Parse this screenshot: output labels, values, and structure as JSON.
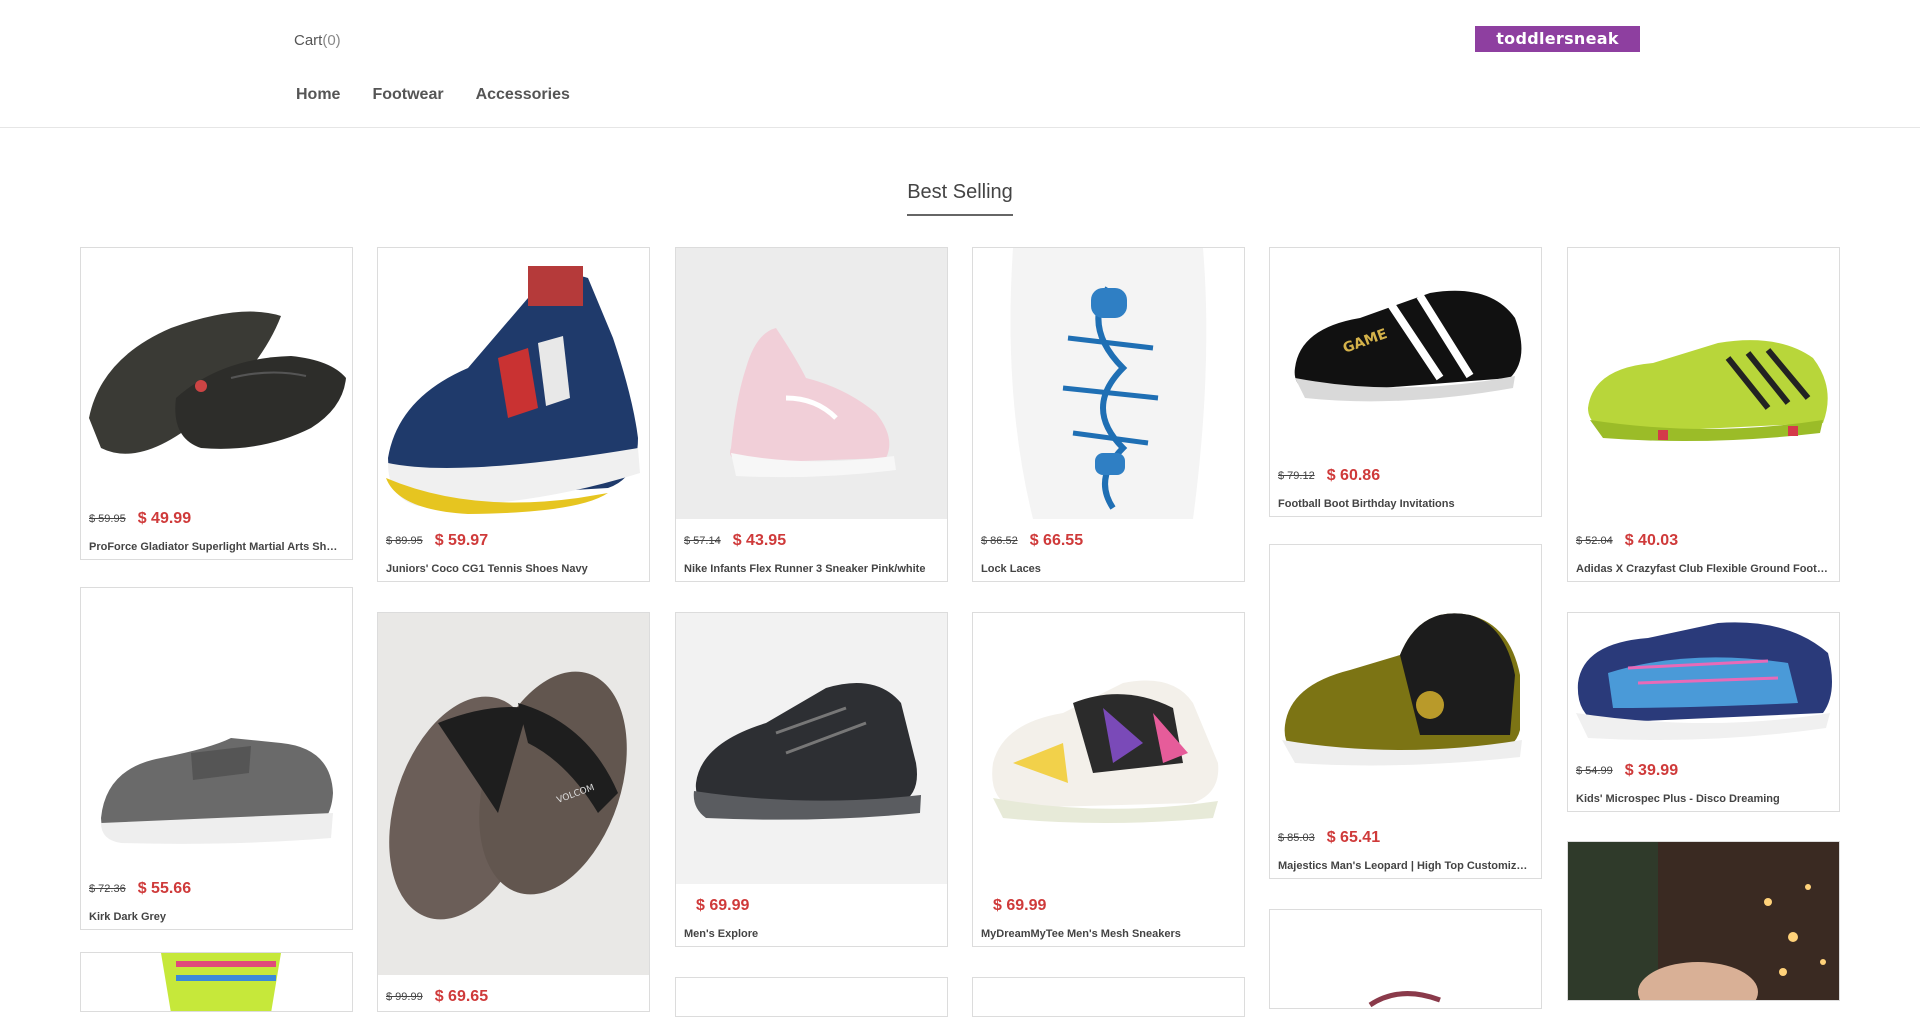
{
  "header": {
    "cart_label": "Cart",
    "cart_count": "(0)",
    "logo_text": "toddlersneak",
    "nav": [
      "Home",
      "Footwear",
      "Accessories"
    ]
  },
  "section_title": "Best Selling",
  "colors": {
    "logo_bg": "#8e3fa0",
    "price": "#cf3a3a"
  },
  "products": [
    {
      "old_price": "$ 59.95",
      "price": "$ 49.99",
      "name": "ProForce Gladiator Superlight Martial Arts Shoes"
    },
    {
      "old_price": "$ 89.95",
      "price": "$ 59.97",
      "name": "Juniors' Coco CG1 Tennis Shoes Navy"
    },
    {
      "old_price": "$ 57.14",
      "price": "$ 43.95",
      "name": "Nike Infants Flex Runner 3 Sneaker Pink/white"
    },
    {
      "old_price": "$ 86.52",
      "price": "$ 66.55",
      "name": "Lock Laces"
    },
    {
      "old_price": "$ 79.12",
      "price": "$ 60.86",
      "name": "Football Boot Birthday Invitations"
    },
    {
      "old_price": "$ 52.04",
      "price": "$ 40.03",
      "name": "Adidas X Crazyfast Club Flexible Ground Football Boots"
    },
    {
      "old_price": "$ 72.36",
      "price": "$ 55.66",
      "name": "Kirk Dark Grey"
    },
    {
      "old_price": "$ 99.99",
      "price": "$ 69.65",
      "name": ""
    },
    {
      "old_price": "",
      "price": "$ 69.99",
      "name": "Men's Explore"
    },
    {
      "old_price": "",
      "price": "$ 69.99",
      "name": "MyDreamMyTee Men's Mesh Sneakers"
    },
    {
      "old_price": "$ 85.03",
      "price": "$ 65.41",
      "name": "Majestics Man's Leopard | High Top Customized Sneakers"
    },
    {
      "old_price": "$ 54.99",
      "price": "$ 39.99",
      "name": "Kids' Microspec Plus - Disco Dreaming"
    }
  ]
}
